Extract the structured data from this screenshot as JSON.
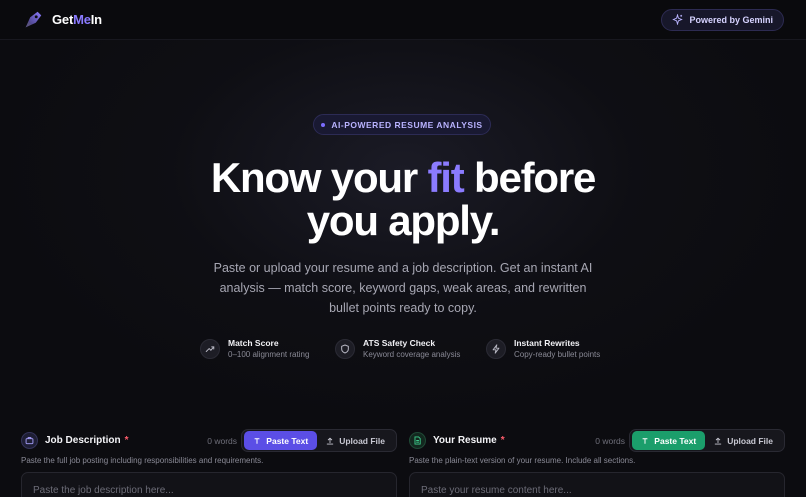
{
  "nav": {
    "brand_prefix": "Get",
    "brand_accent": "Me",
    "brand_suffix": "In",
    "powered_label": "Powered by Gemini"
  },
  "hero": {
    "badge": "AI-POWERED RESUME ANALYSIS",
    "headline_a": "Know your ",
    "headline_accent": "fit",
    "headline_b": " before",
    "headline_line2": "you apply.",
    "subtitle": "Paste or upload your resume and a job description. Get an instant AI analysis — match score, keyword gaps, weak areas, and rewritten bullet points ready to copy."
  },
  "features": [
    {
      "title": "Match Score",
      "desc": "0–100 alignment rating",
      "icon": "trending-up-icon"
    },
    {
      "title": "ATS Safety Check",
      "desc": "Keyword coverage analysis",
      "icon": "shield-icon"
    },
    {
      "title": "Instant Rewrites",
      "desc": "Copy-ready bullet points",
      "icon": "lightning-icon"
    }
  ],
  "panels": {
    "job": {
      "title": "Job Description",
      "required": "*",
      "word_count": "0 words",
      "paste_label": "Paste Text",
      "upload_label": "Upload File",
      "hint": "Paste the full job posting including responsibilities and requirements.",
      "placeholder": "Paste the job description here..."
    },
    "resume": {
      "title": "Your Resume",
      "required": "*",
      "word_count": "0 words",
      "paste_label": "Paste Text",
      "upload_label": "Upload File",
      "hint": "Paste the plain-text version of your resume. Include all sections.",
      "placeholder": "Paste your resume content here..."
    }
  },
  "colors": {
    "accent_purple": "#8b7bff",
    "button_purple": "#5b4ee6",
    "button_green": "#1b9e6b",
    "required_red": "#ff5d6c"
  }
}
